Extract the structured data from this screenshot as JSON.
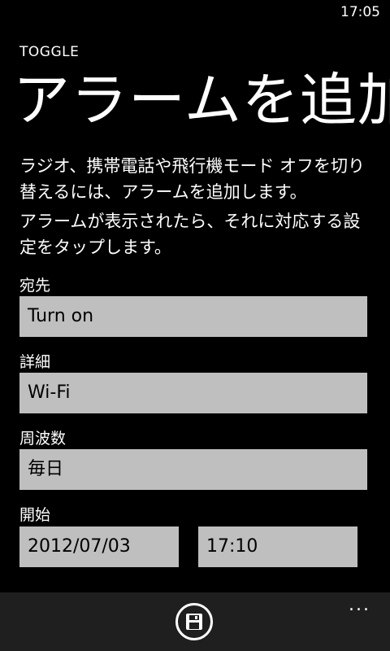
{
  "status_bar": {
    "time": "17:05"
  },
  "header": {
    "app_title": "TOGGLE",
    "page_title": "アラームを追加"
  },
  "description": {
    "line1": "ラジオ、携帯電話や飛行機モード オフを切り替えるには、アラームを追加します。",
    "line2": "アラームが表示されたら、それに対応する設定をタップします。"
  },
  "form": {
    "destination": {
      "label": "宛先",
      "value": "Turn on"
    },
    "detail": {
      "label": "詳細",
      "value": "Wi-Fi"
    },
    "frequency": {
      "label": "周波数",
      "value": "毎日"
    },
    "start": {
      "label": "開始",
      "date": "2012/07/03",
      "time": "17:10"
    }
  },
  "app_bar": {
    "save_icon": "save-icon",
    "more_label": "..."
  }
}
